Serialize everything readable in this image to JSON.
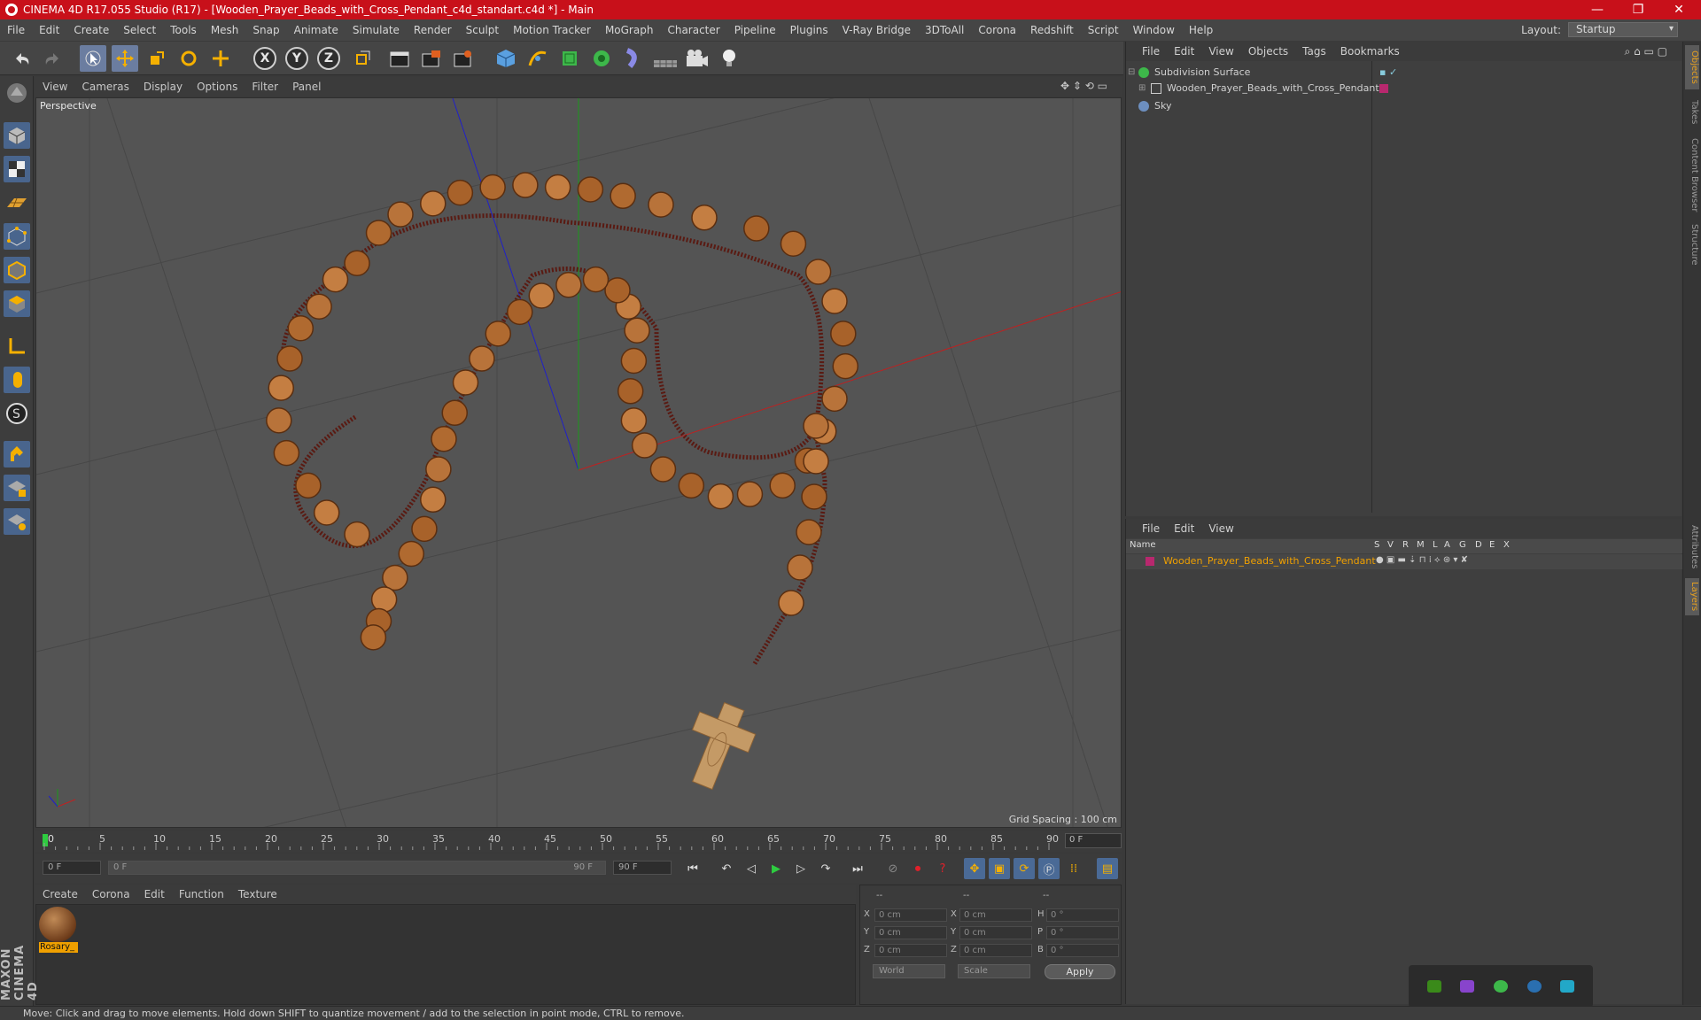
{
  "window": {
    "title": "CINEMA 4D R17.055 Studio (R17) - [Wooden_Prayer_Beads_with_Cross_Pendant_c4d_standart.c4d *] - Main",
    "minimize": "—",
    "maximize": "❐",
    "close": "✕"
  },
  "menubar": {
    "items": [
      "File",
      "Edit",
      "Create",
      "Select",
      "Tools",
      "Mesh",
      "Snap",
      "Animate",
      "Simulate",
      "Render",
      "Sculpt",
      "Motion Tracker",
      "MoGraph",
      "Character",
      "Pipeline",
      "Plugins",
      "V-Ray Bridge",
      "3DToAll",
      "Corona",
      "Redshift",
      "Script",
      "Window",
      "Help"
    ],
    "layout_label": "Layout:",
    "layout_value": "Startup"
  },
  "toolbar": {
    "axis_x": "X",
    "axis_y": "Y",
    "axis_z": "Z"
  },
  "viewport": {
    "menu": [
      "View",
      "Cameras",
      "Display",
      "Options",
      "Filter",
      "Panel"
    ],
    "label": "Perspective",
    "grid_spacing": "Grid Spacing : 100 cm"
  },
  "timeline": {
    "ticks": [
      "0",
      "5",
      "10",
      "15",
      "20",
      "25",
      "30",
      "35",
      "40",
      "45",
      "50",
      "55",
      "60",
      "65",
      "70",
      "75",
      "80",
      "85",
      "90"
    ],
    "frame_field": "0 F"
  },
  "playback": {
    "start": "0 F",
    "range_start": "0 F",
    "range_end": "90 F",
    "end": "90 F"
  },
  "material_manager": {
    "menu": [
      "Create",
      "Corona",
      "Edit",
      "Function",
      "Texture"
    ],
    "materials": [
      {
        "name": "Rosary_"
      }
    ]
  },
  "coordinates": {
    "header": [
      "--",
      "--",
      "--"
    ],
    "rows": [
      {
        "a": "X",
        "v1": "0 cm",
        "b": "X",
        "v2": "0 cm",
        "c": "H",
        "v3": "0 °"
      },
      {
        "a": "Y",
        "v1": "0 cm",
        "b": "Y",
        "v2": "0 cm",
        "c": "P",
        "v3": "0 °"
      },
      {
        "a": "Z",
        "v1": "0 cm",
        "b": "Z",
        "v2": "0 cm",
        "c": "B",
        "v3": "0 °"
      }
    ],
    "mode": "World",
    "transform": "Scale",
    "apply": "Apply"
  },
  "object_manager": {
    "menu": [
      "File",
      "Edit",
      "View",
      "Objects",
      "Tags",
      "Bookmarks"
    ],
    "objects": [
      {
        "name": "Subdivision Surface",
        "color": "#3db84a"
      },
      {
        "name": "Wooden_Prayer_Beads_with_Cross_Pendant",
        "color": "#c8c8c8"
      },
      {
        "name": "Sky",
        "color": "#6d8fbf"
      }
    ]
  },
  "layer_manager": {
    "menu": [
      "File",
      "Edit",
      "View"
    ],
    "columns": [
      "Name",
      "S",
      "V",
      "R",
      "M",
      "L",
      "A",
      "G",
      "D",
      "E",
      "X"
    ],
    "layers": [
      {
        "name": "Wooden_Prayer_Beads_with_Cross_Pendant",
        "color": "#b8286e"
      }
    ]
  },
  "right_tabs": [
    "Objects",
    "Takes",
    "Content Browser",
    "Structure",
    "Attributes",
    "Layers"
  ],
  "status": "Move: Click and drag to move elements. Hold down SHIFT to quantize movement / add to the selection in point mode, CTRL to remove.",
  "branding": "MAXON CINEMA 4D"
}
